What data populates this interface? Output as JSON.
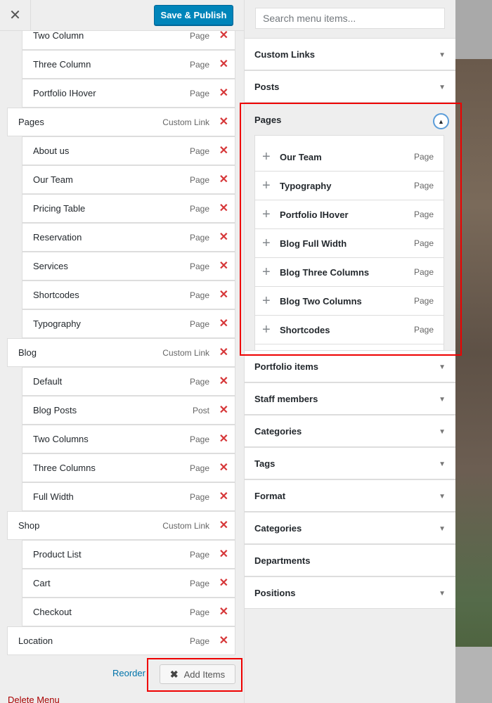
{
  "header": {
    "close_icon": "close-icon",
    "publish_label": "Save & Publish"
  },
  "menu_items": [
    {
      "title": "Two Column",
      "type": "Page",
      "level": "sub"
    },
    {
      "title": "Three Column",
      "type": "Page",
      "level": "sub"
    },
    {
      "title": "Portfolio IHover",
      "type": "Page",
      "level": "sub"
    },
    {
      "title": "Pages",
      "type": "Custom Link",
      "level": "top"
    },
    {
      "title": "About us",
      "type": "Page",
      "level": "sub"
    },
    {
      "title": "Our Team",
      "type": "Page",
      "level": "sub"
    },
    {
      "title": "Pricing Table",
      "type": "Page",
      "level": "sub"
    },
    {
      "title": "Reservation",
      "type": "Page",
      "level": "sub"
    },
    {
      "title": "Services",
      "type": "Page",
      "level": "sub"
    },
    {
      "title": "Shortcodes",
      "type": "Page",
      "level": "sub"
    },
    {
      "title": "Typography",
      "type": "Page",
      "level": "sub"
    },
    {
      "title": "Blog",
      "type": "Custom Link",
      "level": "top"
    },
    {
      "title": "Default",
      "type": "Page",
      "level": "sub"
    },
    {
      "title": "Blog Posts",
      "type": "Post",
      "level": "sub"
    },
    {
      "title": "Two Columns",
      "type": "Page",
      "level": "sub"
    },
    {
      "title": "Three Columns",
      "type": "Page",
      "level": "sub"
    },
    {
      "title": "Full Width",
      "type": "Page",
      "level": "sub"
    },
    {
      "title": "Shop",
      "type": "Custom Link",
      "level": "top"
    },
    {
      "title": "Product List",
      "type": "Page",
      "level": "sub"
    },
    {
      "title": "Cart",
      "type": "Page",
      "level": "sub"
    },
    {
      "title": "Checkout",
      "type": "Page",
      "level": "sub"
    },
    {
      "title": "Location",
      "type": "Page",
      "level": "top"
    }
  ],
  "footer": {
    "reorder_label": "Reorder",
    "add_items_label": "Add Items",
    "delete_menu_label": "Delete Menu"
  },
  "search": {
    "placeholder": "Search menu items..."
  },
  "sections_above": [
    "Custom Links",
    "Posts"
  ],
  "pages_section": {
    "title": "Pages",
    "items": [
      {
        "title": "Our Team",
        "type": "Page"
      },
      {
        "title": "Typography",
        "type": "Page"
      },
      {
        "title": "Portfolio IHover",
        "type": "Page"
      },
      {
        "title": "Blog Full Width",
        "type": "Page"
      },
      {
        "title": "Blog Three Columns",
        "type": "Page"
      },
      {
        "title": "Blog Two Columns",
        "type": "Page"
      },
      {
        "title": "Shortcodes",
        "type": "Page"
      }
    ]
  },
  "sections_below": [
    {
      "title": "Portfolio items",
      "arrow": true
    },
    {
      "title": "Staff members",
      "arrow": true
    },
    {
      "title": "Categories",
      "arrow": true
    },
    {
      "title": "Tags",
      "arrow": true
    },
    {
      "title": "Format",
      "arrow": true
    },
    {
      "title": "Categories",
      "arrow": true
    },
    {
      "title": "Departments",
      "arrow": false
    },
    {
      "title": "Positions",
      "arrow": true
    }
  ],
  "colors": {
    "accent": "#0085ba",
    "delete": "#d63638",
    "highlight": "#e00000"
  }
}
